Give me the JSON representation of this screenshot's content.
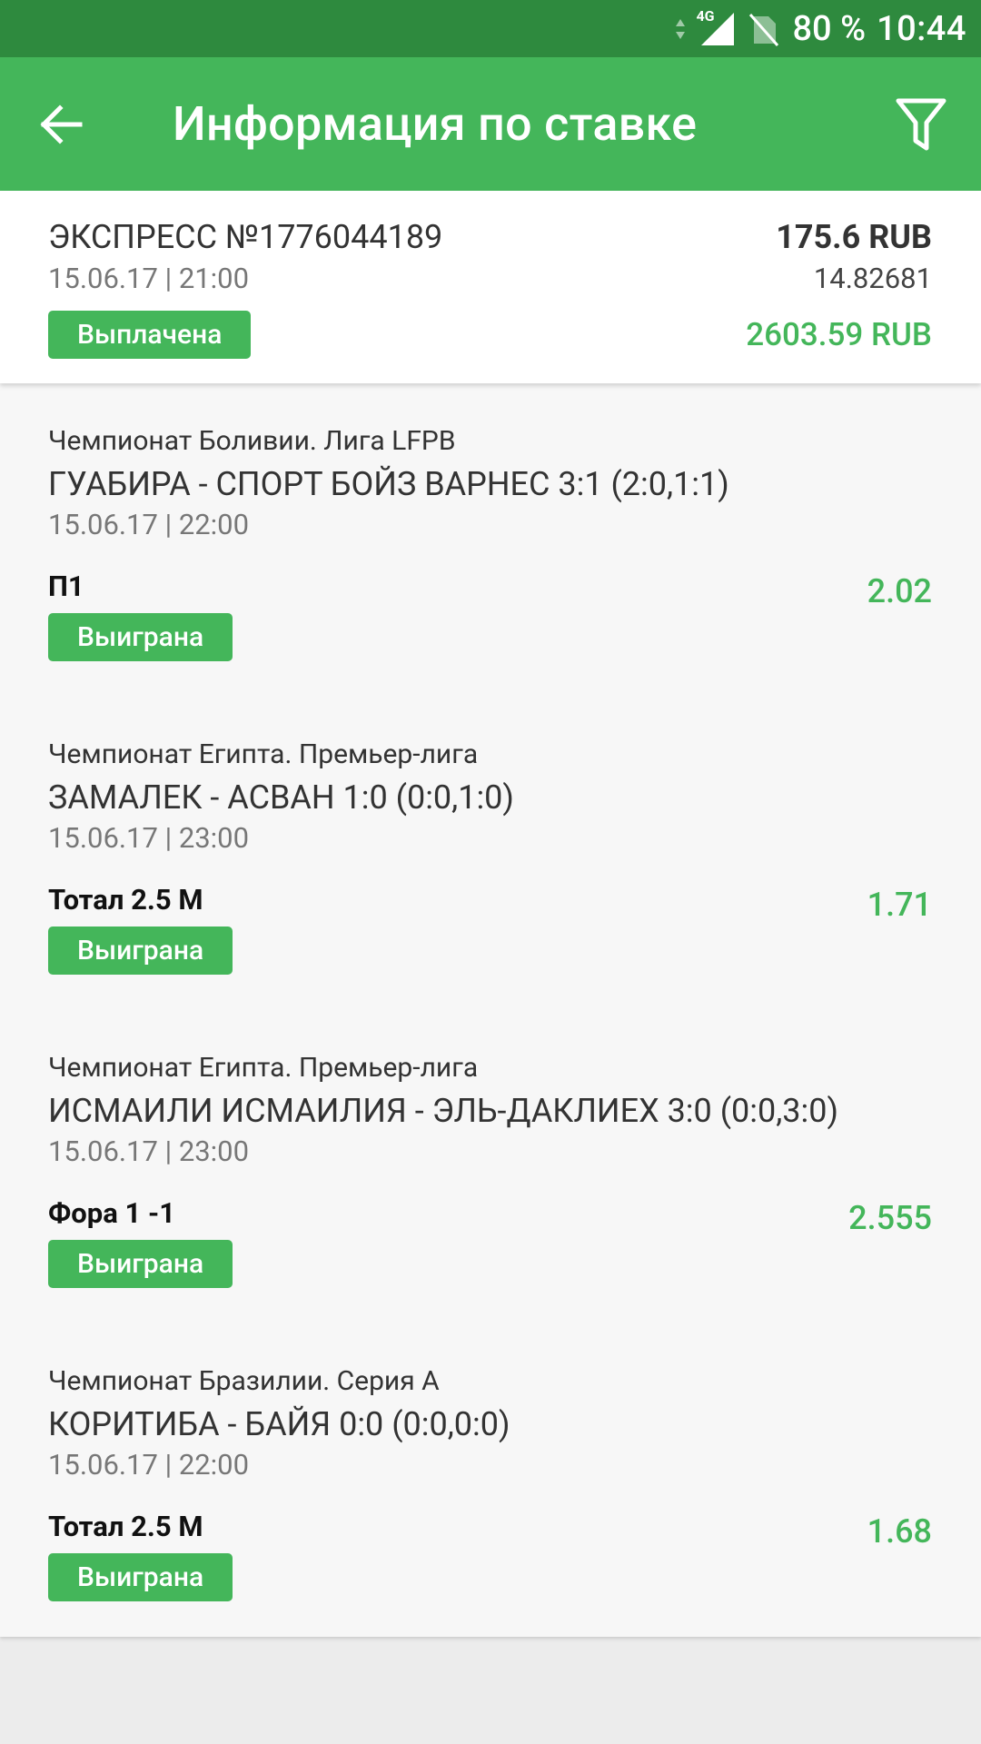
{
  "status_bar": {
    "network": "4G",
    "battery": "80 %",
    "time": "10:44",
    "icons": [
      "data-arrows-icon",
      "signal-icon",
      "no-sim-icon"
    ]
  },
  "app_bar": {
    "title": "Информация по ставке",
    "back_icon": "arrow-back-icon",
    "filter_icon": "filter-icon",
    "color": "#44b65a"
  },
  "bet": {
    "title": "ЭКСПРЕСС №1776044189",
    "date": "15.06.17 | 21:00",
    "status": "Выплачена",
    "stake": "175.6 RUB",
    "coefficient": "14.82681",
    "payout": "2603.59 RUB"
  },
  "events": [
    {
      "league": "Чемпионат Боливии. Лига LFPB",
      "match": "ГУАБИРА - СПОРТ БОЙЗ ВАРНЕС 3:1 (2:0,1:1)",
      "date": "15.06.17 | 22:00",
      "outcome": "П1",
      "status": "Выиграна",
      "odds": "2.02"
    },
    {
      "league": "Чемпионат Египта. Премьер-лига",
      "match": "ЗАМАЛЕК - АСВАН 1:0 (0:0,1:0)",
      "date": "15.06.17 | 23:00",
      "outcome": "Тотал 2.5 М",
      "status": "Выиграна",
      "odds": "1.71"
    },
    {
      "league": "Чемпионат Египта. Премьер-лига",
      "match": "ИСМАИЛИ ИСМАИЛИЯ - ЭЛЬ-ДАКЛИЕХ 3:0 (0:0,3:0)",
      "date": "15.06.17 | 23:00",
      "outcome": "Фора 1 -1",
      "status": "Выиграна",
      "odds": "2.555"
    },
    {
      "league": "Чемпионат Бразилии. Серия А",
      "match": "КОРИТИБА - БАЙЯ 0:0 (0:0,0:0)",
      "date": "15.06.17 | 22:00",
      "outcome": "Тотал 2.5 М",
      "status": "Выиграна",
      "odds": "1.68"
    }
  ]
}
